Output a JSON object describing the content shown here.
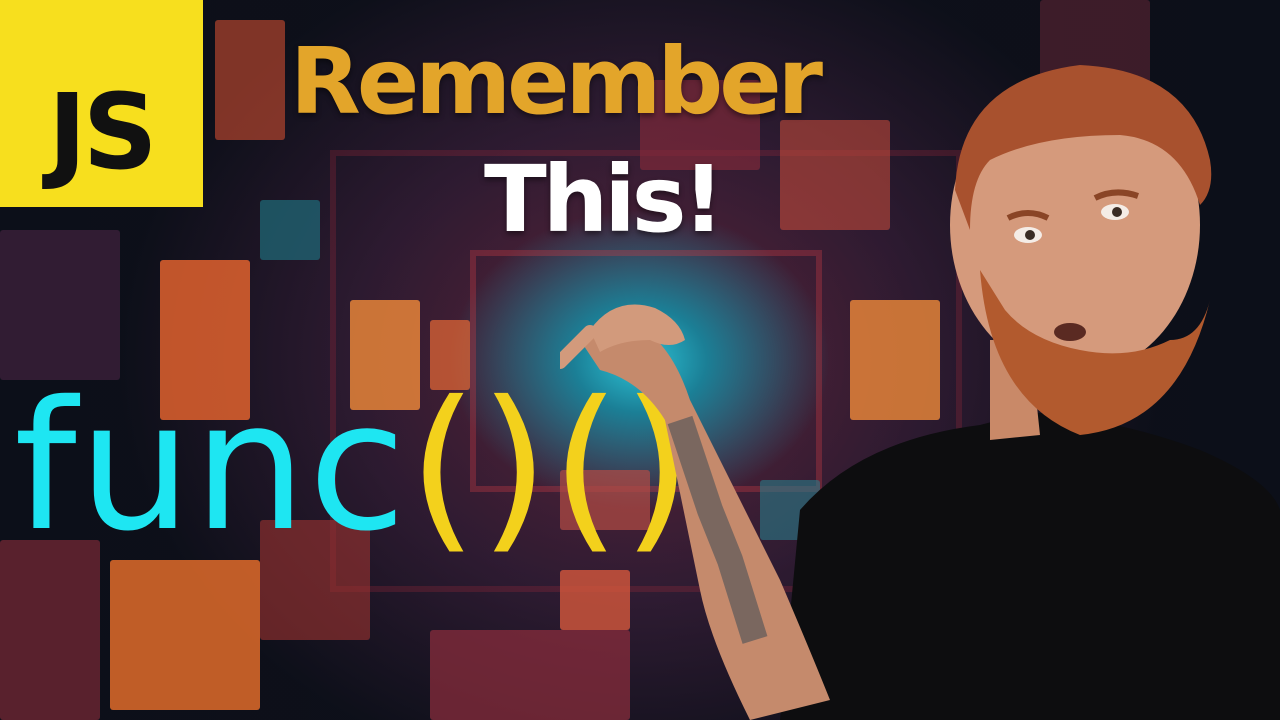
{
  "thumbnail": {
    "logo": {
      "text": "JS",
      "background": "#f7df1e",
      "text_color": "#111111"
    },
    "title": {
      "line1": "Remember",
      "line2": "This!",
      "line1_color": "#e3a52a",
      "line2_color": "#ffffff"
    },
    "code": {
      "name": "func",
      "parens": "()()",
      "name_color": "#1ee6f2",
      "parens_color": "#f3d11c"
    }
  }
}
